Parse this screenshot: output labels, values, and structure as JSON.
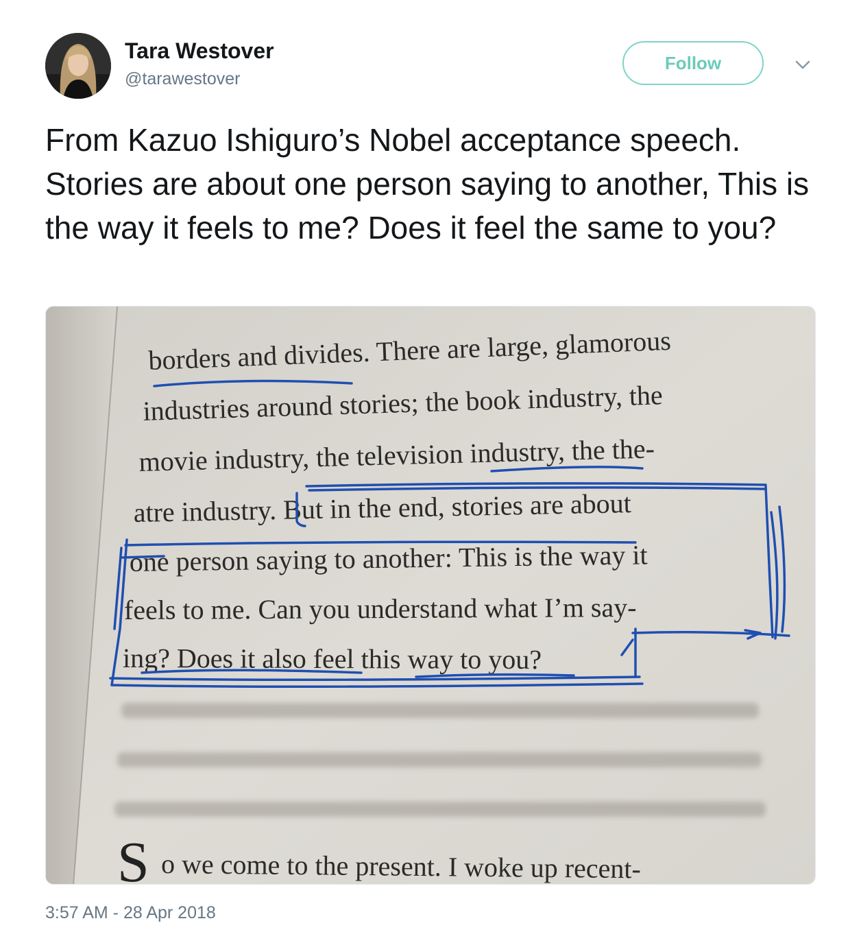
{
  "author": {
    "name": "Tara Westover",
    "handle": "@tarawestover"
  },
  "follow_button": {
    "label": "Follow"
  },
  "more_menu": {
    "icon": "chevron-down-icon"
  },
  "tweet": {
    "text": "From Kazuo Ishiguro’s Nobel acceptance speech. Stories are about one person saying to another, This is the way it feels to me? Does it feel the same to you?",
    "timestamp": "3:57 AM - 28 Apr 2018"
  },
  "photo": {
    "book_lines": [
      "borders and divides. There are large, glamorous",
      "industries around stories; the book industry, the",
      "movie industry, the television industry, the the-",
      "atre industry. But in the end, stories are about",
      "one person saying to another: This is the way it",
      "feels to me. Can you understand what I’m say-",
      "ing? Does it also feel this way to you?",
      "o we come to the present. I woke up recent-"
    ],
    "drop_cap": "S",
    "ink_color": "#1f4fb0",
    "paper_color": "#dcd9d3"
  },
  "colors": {
    "follow_accent": "#6ccbb9",
    "muted_text": "#657786",
    "primary_text": "#14171a"
  }
}
